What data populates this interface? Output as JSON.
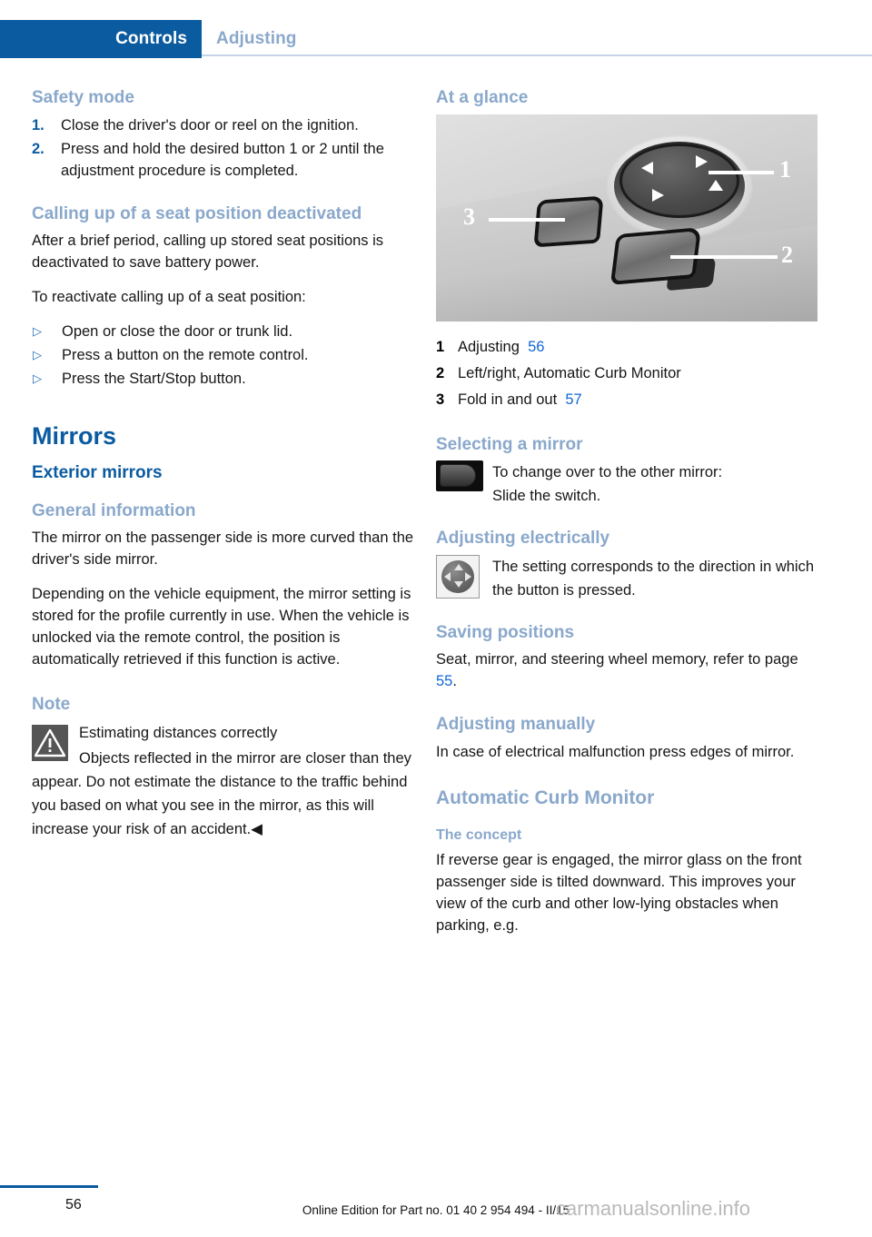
{
  "header": {
    "active_tab": "Controls",
    "inactive_tab": "Adjusting",
    "accent_color": "#0b5ba0",
    "muted_color": "#8aa8cb"
  },
  "left_column": {
    "safety_mode": {
      "heading": "Safety mode",
      "steps": [
        {
          "marker": "1.",
          "text": "Close the driver's door or reel on the ignition."
        },
        {
          "marker": "2.",
          "text": "Press and hold the desired button 1 or 2 until the adjustment procedure is completed."
        }
      ]
    },
    "calling_up": {
      "heading": "Calling up of a seat position deactivated",
      "paragraph_1": "After a brief period, calling up stored seat positions is deactivated to save battery power.",
      "paragraph_2": "To reactivate calling up of a seat position:",
      "bullets": [
        {
          "marker": "▷",
          "text": "Open or close the door or trunk lid."
        },
        {
          "marker": "▷",
          "text": "Press a button on the remote control."
        },
        {
          "marker": "▷",
          "text": "Press the Start/Stop button."
        }
      ]
    },
    "mirrors": {
      "title": "Mirrors",
      "section": "Exterior mirrors",
      "general": {
        "heading": "General information",
        "paragraph_1": "The mirror on the passenger side is more curved than the driver's side mirror.",
        "paragraph_2": "Depending on the vehicle equipment, the mirror setting is stored for the profile currently in use. When the vehicle is unlocked via the remote control, the position is automatically retrieved if this function is active."
      },
      "note": {
        "heading": "Note",
        "title": "Estimating distances correctly",
        "body": "Objects reflected in the mirror are closer than they appear. Do not estimate the distance to the traffic behind you based on what you see in the mirror, as this will increase your risk of an accident.◀"
      }
    }
  },
  "right_column": {
    "at_a_glance": {
      "heading": "At a glance",
      "figure": {
        "alt": "mirror-control-panel-photo",
        "callouts": [
          "1",
          "2",
          "3"
        ]
      },
      "legend": [
        {
          "num": "1",
          "label": "Adjusting",
          "page_ref": "56"
        },
        {
          "num": "2",
          "label": "Left/right, Automatic Curb Monitor",
          "page_ref": ""
        },
        {
          "num": "3",
          "label": "Fold in and out",
          "page_ref": "57"
        }
      ]
    },
    "selecting_mirror": {
      "heading": "Selecting a mirror",
      "icon": "rocker-switch-icon",
      "line_1": "To change over to the other mirror:",
      "line_2": "Slide the switch."
    },
    "adjusting_electrically": {
      "heading": "Adjusting electrically",
      "icon": "four-way-button-icon",
      "text": "The setting corresponds to the direction in which the button is pressed."
    },
    "saving_positions": {
      "heading": "Saving positions",
      "text_before": "Seat, mirror, and steering wheel memory, refer to page ",
      "page_ref": "55",
      "text_after": "."
    },
    "adjusting_manually": {
      "heading": "Adjusting manually",
      "text": "In case of electrical malfunction press edges of mirror."
    },
    "automatic_curb_monitor": {
      "heading": "Automatic Curb Monitor",
      "subheading": "The concept",
      "text": "If reverse gear is engaged, the mirror glass on the front passenger side is tilted downward. This improves your view of the curb and other low-lying obstacles when parking, e.g."
    }
  },
  "footer": {
    "page_number": "56",
    "edition_note": "Online Edition for Part no. 01 40 2 954 494 - II/15",
    "watermark": "carmanualsonline.info"
  }
}
